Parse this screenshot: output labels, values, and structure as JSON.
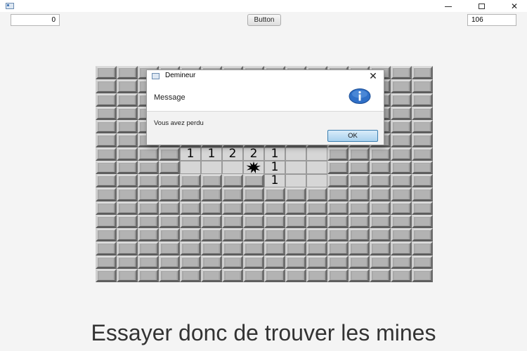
{
  "window": {
    "min_symbol": "—",
    "close_symbol": "✕"
  },
  "toolbar": {
    "left_counter": "0",
    "button_label": "Button",
    "right_counter": "106"
  },
  "board": {
    "cols": 16,
    "rows": 16,
    "cells": [
      {
        "row": 6,
        "col": 4,
        "value": "1"
      },
      {
        "row": 6,
        "col": 5,
        "value": "1"
      },
      {
        "row": 6,
        "col": 6,
        "value": "2"
      },
      {
        "row": 6,
        "col": 7,
        "value": "2"
      },
      {
        "row": 6,
        "col": 8,
        "value": "1"
      },
      {
        "row": 6,
        "col": 9,
        "value": ""
      },
      {
        "row": 6,
        "col": 10,
        "value": ""
      },
      {
        "row": 7,
        "col": 4,
        "value": ""
      },
      {
        "row": 7,
        "col": 5,
        "value": ""
      },
      {
        "row": 7,
        "col": 6,
        "value": ""
      },
      {
        "row": 7,
        "col": 7,
        "value": "mine"
      },
      {
        "row": 7,
        "col": 8,
        "value": "1"
      },
      {
        "row": 7,
        "col": 9,
        "value": ""
      },
      {
        "row": 7,
        "col": 10,
        "value": ""
      },
      {
        "row": 8,
        "col": 8,
        "value": "1"
      },
      {
        "row": 8,
        "col": 9,
        "value": ""
      },
      {
        "row": 8,
        "col": 10,
        "value": ""
      }
    ]
  },
  "dialog": {
    "title": "Demineur",
    "close_symbol": "✕",
    "header": "Message",
    "icon": "info-icon",
    "content": "Vous avez perdu",
    "ok_label": "OK"
  },
  "footer": {
    "text": "Essayer donc de trouver les mines"
  }
}
